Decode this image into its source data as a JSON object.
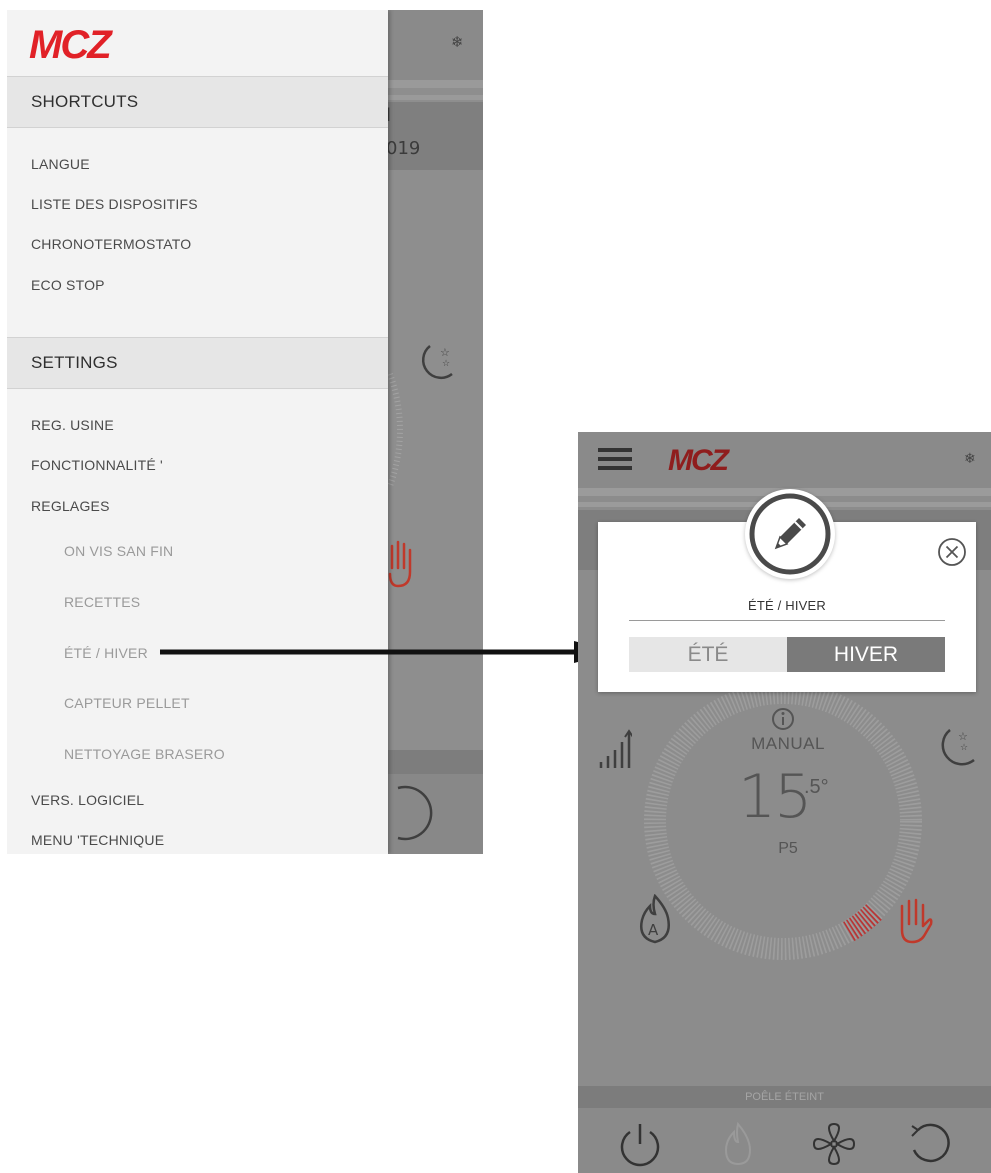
{
  "brand": {
    "logo_text": "MCZ",
    "logo_color": "#e12127"
  },
  "left_screen": {
    "background_fragments": {
      "line1": "l",
      "line2": "019"
    },
    "shortcuts_header": "SHORTCUTS",
    "shortcuts_items": [
      "LANGUE",
      "LISTE DES DISPOSITIFS",
      "CHRONOTERMOSTATO",
      "ECO STOP"
    ],
    "settings_header": "SETTINGS",
    "settings_items": [
      "REG. USINE",
      "FONCTIONNALITÉ '",
      "REGLAGES"
    ],
    "reglages_subitems": [
      "ON VIS SAN FIN",
      "RECETTES",
      "ÉTÉ / HIVER",
      "CAPTEUR PELLET",
      "NETTOYAGE BRASERO"
    ],
    "more_items": [
      "VERS. LOGICIEL",
      "MENU 'TECHNIQUE"
    ]
  },
  "right_screen": {
    "dialog": {
      "title": "ÉTÉ / HIVER",
      "option_ete": "ÉTÉ",
      "option_hiver": "HIVER",
      "selected": "HIVER"
    },
    "mode": "MANUAL",
    "temperature": "15",
    "temperature_decimal": ".5°",
    "power_level": "P5",
    "status": "POÊLE ÉTEINT"
  },
  "colors": {
    "accent_red": "#e12127",
    "overlay_grey": "#8c8c8c",
    "selected_segment": "#7a7a7a"
  }
}
